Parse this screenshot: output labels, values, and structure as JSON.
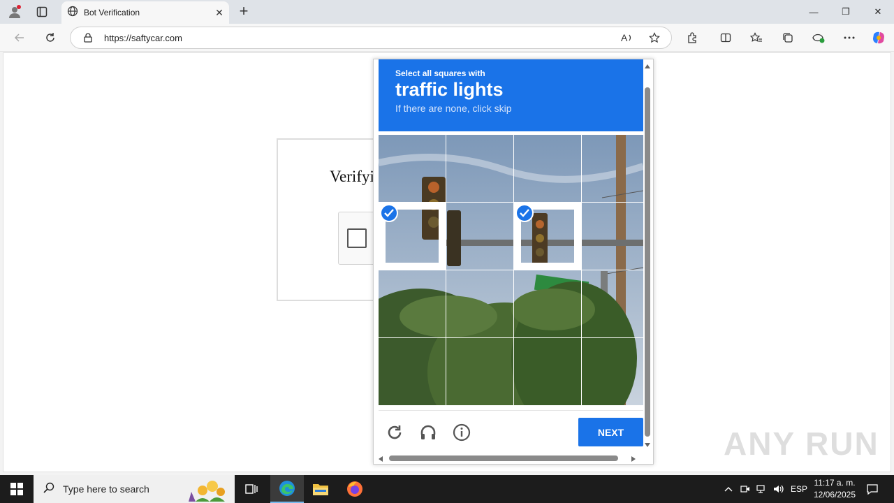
{
  "browser": {
    "tab_title": "Bot Verification",
    "tab_close": "✕",
    "new_tab": "+",
    "url": "https://saftycar.com",
    "window_controls": {
      "minimize": "—",
      "restore": "❐",
      "close": "✕"
    }
  },
  "page": {
    "verify_title_partial": "Verifyi"
  },
  "captcha": {
    "instruction_line1": "Select all squares with",
    "target_object": "traffic lights",
    "instruction_line3": "If there are none, click skip",
    "grid_rows": 4,
    "grid_cols": 4,
    "selected_tiles": [
      4,
      6
    ],
    "next_label": "NEXT",
    "icons": [
      "reload-icon",
      "audio-icon",
      "info-icon"
    ],
    "accent_color": "#1a73e8"
  },
  "watermark": "ANY RUN",
  "taskbar": {
    "search_placeholder": "Type here to search",
    "language": "ESP",
    "time": "11:17 a. m.",
    "date": "12/06/2025"
  }
}
